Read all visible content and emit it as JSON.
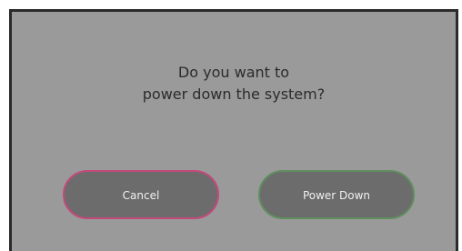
{
  "dialog": {
    "message_line1": "Do you want to",
    "message_line2": "power down the system?",
    "cancel_label": "Cancel",
    "confirm_label": "Power Down"
  },
  "colors": {
    "dialog_background": "#9a9a9a",
    "button_fill": "#6c6c6c",
    "cancel_border": "#c4497a",
    "confirm_border": "#5f8f5f"
  }
}
